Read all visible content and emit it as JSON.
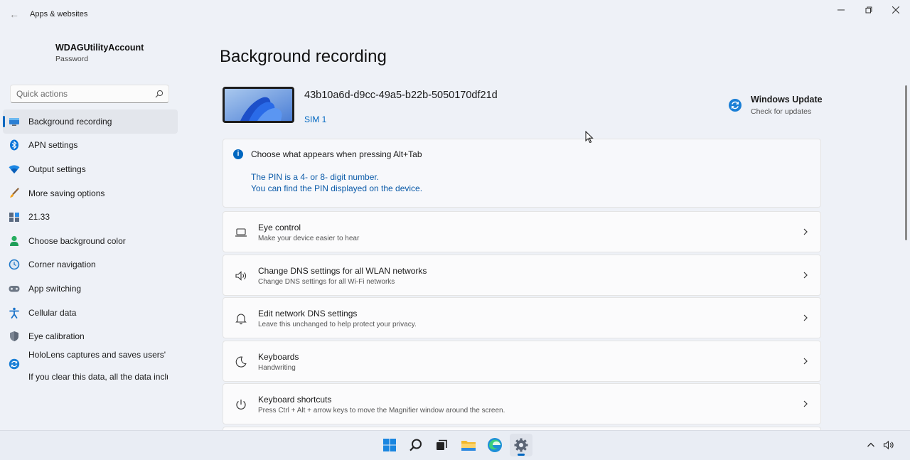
{
  "window": {
    "app_title": "Apps & websites",
    "back_glyph": "←"
  },
  "profile": {
    "name": "WDAGUtilityAccount",
    "subtitle": "Password"
  },
  "search": {
    "placeholder": "Quick actions"
  },
  "sidebar": {
    "items": [
      {
        "label": "Background recording",
        "icon": "monitor-icon",
        "active": true
      },
      {
        "label": "APN settings",
        "icon": "bluetooth-icon"
      },
      {
        "label": "Output settings",
        "icon": "wifi-icon"
      },
      {
        "label": "More saving options",
        "icon": "brush-icon"
      },
      {
        "label": "21.33",
        "icon": "apps-icon"
      },
      {
        "label": "Choose background color",
        "icon": "person-icon"
      },
      {
        "label": "Corner navigation",
        "icon": "clock-icon"
      },
      {
        "label": "App switching",
        "icon": "gamepad-icon"
      },
      {
        "label": "Cellular data",
        "icon": "accessibility-icon"
      },
      {
        "label": "Eye calibration",
        "icon": "shield-icon"
      }
    ],
    "multi_item": {
      "line1": "HoloLens captures and saves users' e",
      "line2": "If you clear this data, all the data inclu",
      "icon": "update-icon"
    }
  },
  "main": {
    "title": "Background recording",
    "device": {
      "name": "43b10a6d-d9cc-49a5-b22b-5050170df21d",
      "link": "SIM 1"
    },
    "windows_update": {
      "title": "Windows Update",
      "subtitle": "Check for updates"
    },
    "info": {
      "heading": "Choose what appears when pressing Alt+Tab",
      "line1": "The PIN is a 4- or 8- digit number.",
      "line2": "You can find the PIN displayed on the device."
    },
    "cards": [
      {
        "title": "Eye control",
        "subtitle": "Make your device easier to hear",
        "icon": "laptop-icon"
      },
      {
        "title": "Change DNS settings for all WLAN networks",
        "subtitle": "Change DNS settings for all Wi-Fi networks",
        "icon": "speaker-icon"
      },
      {
        "title": "Edit network DNS settings",
        "subtitle": "Leave this unchanged to help protect your privacy.",
        "icon": "bell-icon"
      },
      {
        "title": "Keyboards",
        "subtitle": "Handwriting",
        "icon": "moon-icon"
      },
      {
        "title": "Keyboard shortcuts",
        "subtitle": "Press Ctrl + Alt + arrow keys to move the Magnifier window around the screen.",
        "icon": "power-icon"
      }
    ]
  },
  "taskbar": {
    "apps": [
      "windows-start-icon",
      "search-icon",
      "task-view-icon",
      "file-explorer-icon",
      "edge-icon",
      "settings-icon"
    ]
  },
  "colors": {
    "accent": "#0067c0",
    "window_bg": "#eef1f7",
    "card_bg": "#fbfbfc"
  }
}
